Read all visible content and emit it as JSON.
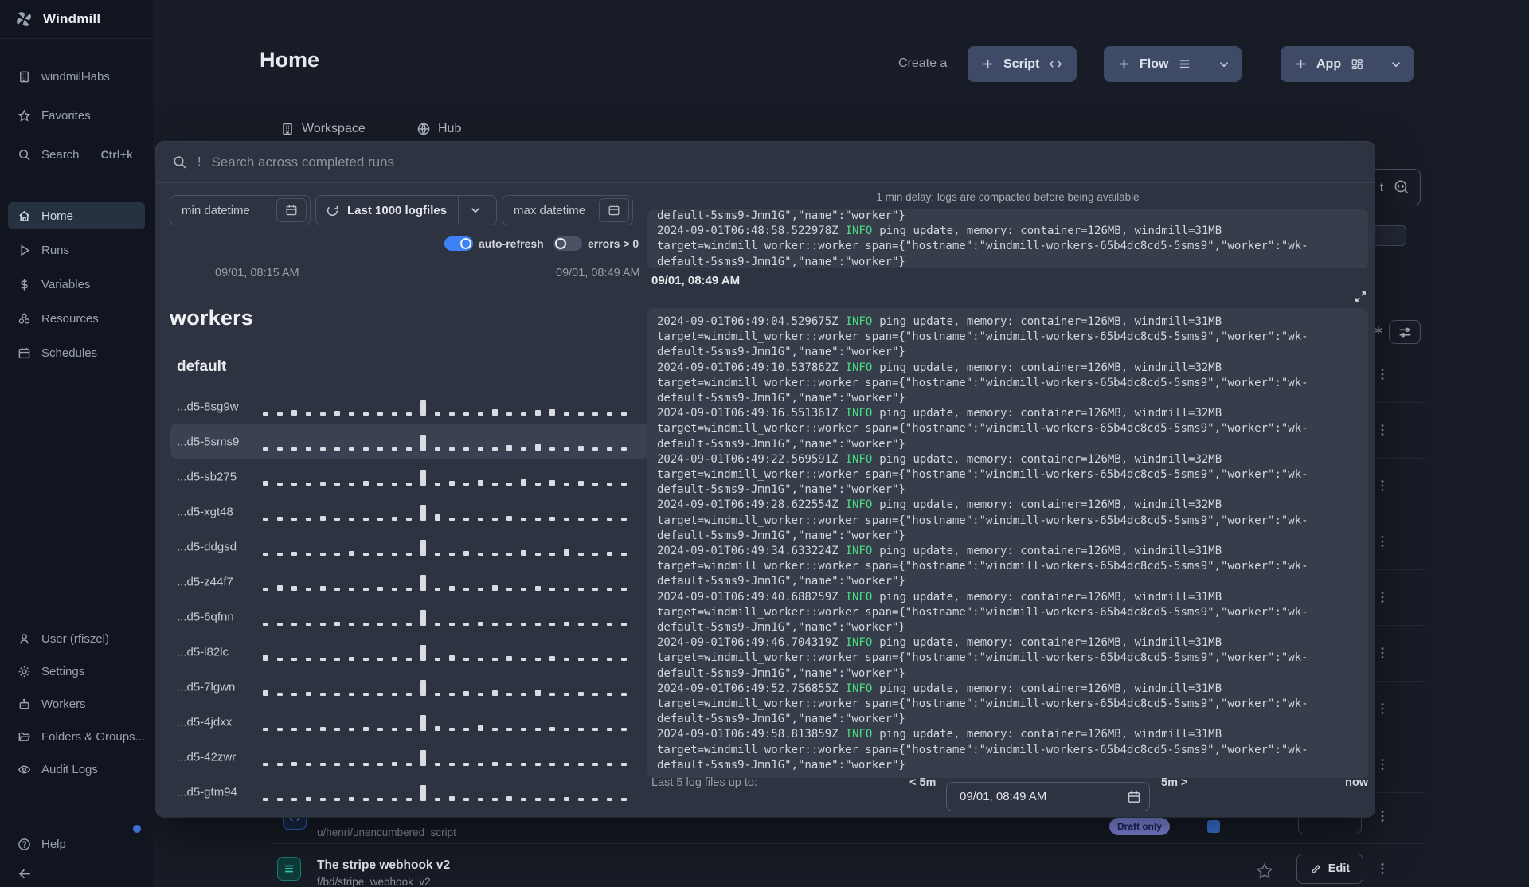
{
  "app": {
    "name": "Windmill"
  },
  "sidebar": {
    "workspace": "windmill-labs",
    "favorites": "Favorites",
    "search": "Search",
    "search_shortcut": "Ctrl+k",
    "nav": {
      "home": "Home",
      "runs": "Runs",
      "variables": "Variables",
      "resources": "Resources",
      "schedules": "Schedules"
    },
    "bottom": {
      "user": "User (rfiszel)",
      "settings": "Settings",
      "workers": "Workers",
      "folders": "Folders & Groups...",
      "audit": "Audit Logs",
      "help": "Help"
    }
  },
  "header": {
    "title": "Home",
    "create_label": "Create a",
    "script_label": "Script",
    "flow_label": "Flow",
    "app_label": "App",
    "tab_workspace": "Workspace",
    "tab_hub": "Hub"
  },
  "background": {
    "search_tail": "t",
    "row_a": {
      "subtitle": "u/henri/unencumbered_script",
      "badge": "Draft only"
    },
    "row_b": {
      "title": "The stripe webhook v2",
      "subtitle": "f/bd/stripe_webhook_v2",
      "edit_label": "Edit"
    }
  },
  "modal": {
    "search_prefix": "!",
    "search_placeholder": "Search across completed runs",
    "min_datetime_label": "min datetime",
    "logfiles_label": "Last 1000 logfiles",
    "max_datetime_label": "max datetime",
    "auto_refresh_label": "auto-refresh",
    "errors_label": "errors > 0",
    "range_start": "09/01, 08:15 AM",
    "range_end": "09/01, 08:49 AM",
    "workers_title": "workers",
    "group_title": "default",
    "workers": [
      {
        "name": "...d5-8sg9w",
        "selected": false,
        "bars": [
          0.08,
          0.08,
          0.22,
          0.1,
          0.08,
          0.2,
          0.08,
          0.08,
          0.12,
          0.08,
          0.08,
          1,
          0.12,
          0.08,
          0.08,
          0.08,
          0.3,
          0.08,
          0.08,
          0.25,
          0.3,
          0.08,
          0.08,
          0.08,
          0.08,
          0.08
        ]
      },
      {
        "name": "...d5-5sms9",
        "selected": true,
        "bars": [
          0.08,
          0.08,
          0.08,
          0.1,
          0.08,
          0.08,
          0.08,
          0.08,
          0.1,
          0.08,
          0.08,
          1,
          0.08,
          0.08,
          0.08,
          0.08,
          0.08,
          0.25,
          0.08,
          0.3,
          0.08,
          0.08,
          0.2,
          0.08,
          0.08,
          0.08
        ]
      },
      {
        "name": "...d5-sb275",
        "selected": false,
        "bars": [
          0.15,
          0.08,
          0.08,
          0.08,
          0.1,
          0.08,
          0.08,
          0.2,
          0.08,
          0.08,
          0.08,
          1,
          0.08,
          0.15,
          0.08,
          0.25,
          0.08,
          0.08,
          0.3,
          0.08,
          0.25,
          0.08,
          0.15,
          0.08,
          0.08,
          0.08
        ]
      },
      {
        "name": "...d5-xgt48",
        "selected": false,
        "bars": [
          0.08,
          0.1,
          0.08,
          0.08,
          0.2,
          0.08,
          0.08,
          0.08,
          0.08,
          0.12,
          0.08,
          1,
          0.3,
          0.08,
          0.08,
          0.08,
          0.08,
          0.2,
          0.08,
          0.08,
          0.1,
          0.08,
          0.08,
          0.08,
          0.08,
          0.08
        ]
      },
      {
        "name": "...d5-ddgsd",
        "selected": false,
        "bars": [
          0.08,
          0.08,
          0.1,
          0.08,
          0.08,
          0.08,
          0.15,
          0.08,
          0.08,
          0.08,
          0.08,
          1,
          0.08,
          0.08,
          0.2,
          0.08,
          0.08,
          0.08,
          0.25,
          0.08,
          0.08,
          0.3,
          0.08,
          0.08,
          0.1,
          0.08
        ]
      },
      {
        "name": "...d5-z44f7",
        "selected": false,
        "bars": [
          0.08,
          0.25,
          0.2,
          0.08,
          0.15,
          0.08,
          0.08,
          0.08,
          0.1,
          0.08,
          0.08,
          1,
          0.08,
          0.2,
          0.08,
          0.08,
          0.25,
          0.08,
          0.08,
          0.15,
          0.08,
          0.08,
          0.08,
          0.08,
          0.08,
          0.08
        ]
      },
      {
        "name": "...d5-6qfnn",
        "selected": false,
        "bars": [
          0.08,
          0.08,
          0.08,
          0.08,
          0.08,
          0.1,
          0.08,
          0.08,
          0.08,
          0.08,
          0.08,
          1,
          0.08,
          0.08,
          0.08,
          0.1,
          0.08,
          0.08,
          0.08,
          0.08,
          0.08,
          0.12,
          0.08,
          0.08,
          0.08,
          0.08
        ]
      },
      {
        "name": "...d5-l82lc",
        "selected": false,
        "bars": [
          0.3,
          0.08,
          0.08,
          0.08,
          0.08,
          0.08,
          0.1,
          0.08,
          0.08,
          0.12,
          0.08,
          1,
          0.08,
          0.25,
          0.08,
          0.08,
          0.08,
          0.2,
          0.08,
          0.08,
          0.15,
          0.08,
          0.08,
          0.08,
          0.08,
          0.08
        ]
      },
      {
        "name": "...d5-7lgwn",
        "selected": false,
        "bars": [
          0.25,
          0.08,
          0.08,
          0.1,
          0.08,
          0.08,
          0.08,
          0.08,
          0.08,
          0.08,
          0.08,
          1,
          0.08,
          0.08,
          0.2,
          0.08,
          0.25,
          0.08,
          0.08,
          0.3,
          0.08,
          0.08,
          0.12,
          0.08,
          0.08,
          0.08
        ]
      },
      {
        "name": "...d5-4jdxx",
        "selected": false,
        "bars": [
          0.08,
          0.08,
          0.08,
          0.08,
          0.12,
          0.08,
          0.08,
          0.1,
          0.08,
          0.08,
          0.08,
          1,
          0.2,
          0.08,
          0.08,
          0.25,
          0.08,
          0.08,
          0.08,
          0.08,
          0.1,
          0.08,
          0.08,
          0.08,
          0.08,
          0.08
        ]
      },
      {
        "name": "...d5-42zwr",
        "selected": false,
        "bars": [
          0.08,
          0.08,
          0.1,
          0.08,
          0.08,
          0.08,
          0.08,
          0.08,
          0.08,
          0.1,
          0.08,
          1,
          0.08,
          0.08,
          0.08,
          0.08,
          0.12,
          0.08,
          0.08,
          0.08,
          0.08,
          0.08,
          0.08,
          0.08,
          0.08,
          0.08
        ]
      },
      {
        "name": "...d5-gtm94",
        "selected": false,
        "bars": [
          0.08,
          0.08,
          0.08,
          0.12,
          0.08,
          0.08,
          0.1,
          0.08,
          0.08,
          0.08,
          0.08,
          1,
          0.08,
          0.15,
          0.08,
          0.08,
          0.08,
          0.2,
          0.08,
          0.08,
          0.08,
          0.1,
          0.08,
          0.08,
          0.08,
          0.08
        ]
      }
    ],
    "log": {
      "delay_notice": "1 min delay: logs are compacted before being available",
      "level": "INFO",
      "prev_entry": {
        "time": "2024-09-01T06:48:58.522978Z",
        "msg": "ping update, memory: container=126MB, windmill=31MB"
      },
      "cont_lines": [
        "target=windmill_worker::worker span={\"hostname\":\"windmill-workers-65b4dc8cd5-5sms9\",\"worker\":\"wk-",
        "default-5sms9-Jmn1G\",\"name\":\"worker\"}"
      ],
      "section_time": "09/01, 08:49 AM",
      "entries": [
        {
          "time": "2024-09-01T06:49:04.529675Z",
          "msg": "ping update, memory: container=126MB, windmill=31MB"
        },
        {
          "time": "2024-09-01T06:49:10.537862Z",
          "msg": "ping update, memory: container=126MB, windmill=32MB"
        },
        {
          "time": "2024-09-01T06:49:16.551361Z",
          "msg": "ping update, memory: container=126MB, windmill=32MB"
        },
        {
          "time": "2024-09-01T06:49:22.569591Z",
          "msg": "ping update, memory: container=126MB, windmill=32MB"
        },
        {
          "time": "2024-09-01T06:49:28.622554Z",
          "msg": "ping update, memory: container=126MB, windmill=32MB"
        },
        {
          "time": "2024-09-01T06:49:34.633224Z",
          "msg": "ping update, memory: container=126MB, windmill=31MB"
        },
        {
          "time": "2024-09-01T06:49:40.688259Z",
          "msg": "ping update, memory: container=126MB, windmill=31MB"
        },
        {
          "time": "2024-09-01T06:49:46.704319Z",
          "msg": "ping update, memory: container=126MB, windmill=31MB"
        },
        {
          "time": "2024-09-01T06:49:52.756855Z",
          "msg": "ping update, memory: container=126MB, windmill=31MB"
        },
        {
          "time": "2024-09-01T06:49:58.813859Z",
          "msg": "ping update, memory: container=126MB, windmill=31MB"
        }
      ],
      "footer": {
        "label": "Last 5 log files up to:",
        "back": "< 5m",
        "datetime": "09/01, 08:49 AM",
        "forward": "5m >",
        "now": "now"
      }
    }
  }
}
